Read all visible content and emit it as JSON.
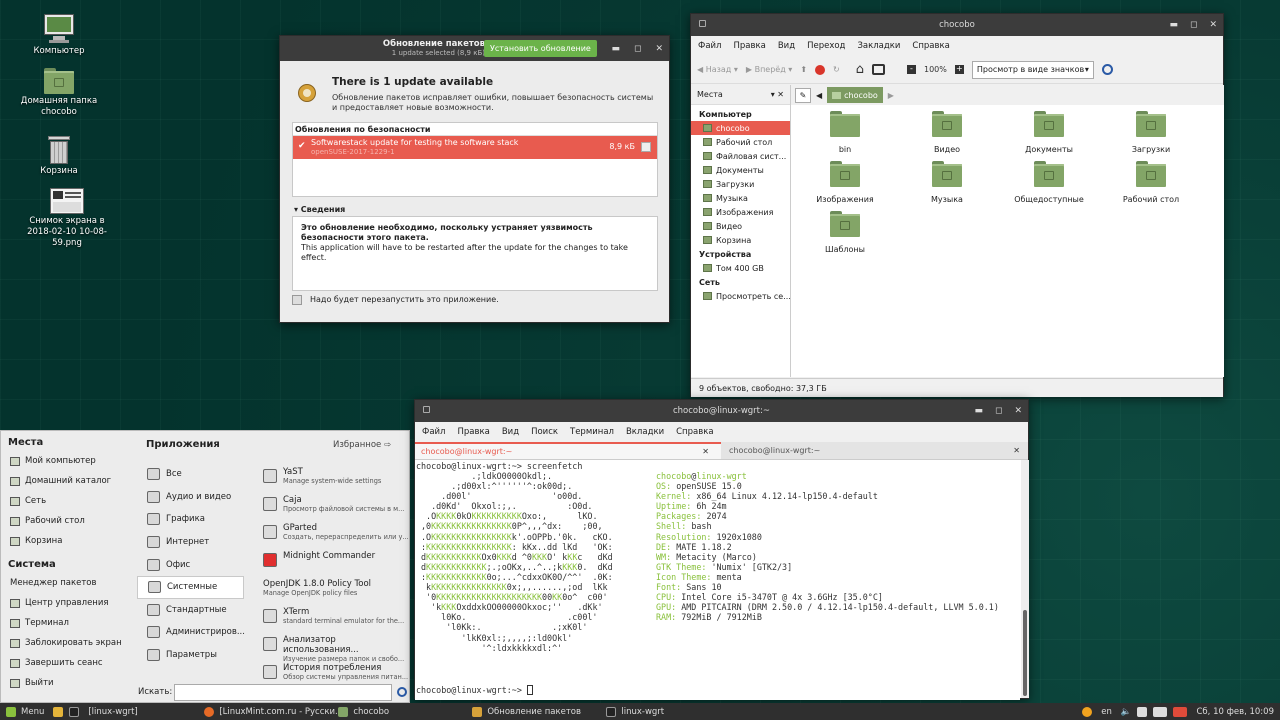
{
  "desktop": {
    "icons": [
      {
        "label": "Компьютер"
      },
      {
        "label": "Домашняя папка chocobo"
      },
      {
        "label": "Корзина"
      },
      {
        "label": "Снимок экрана в 2018-02-10 10-08-59.png"
      }
    ]
  },
  "updater": {
    "title": "Обновление пакетов",
    "subtitle": "1 update selected (8,9 кБ)",
    "install_button": "Установить обновление",
    "heading": "There is 1 update available",
    "description": "Обновление пакетов исправляет ошибки, повышает безопасность системы и предоставляет новые возможности.",
    "section": "Обновления по безопасности",
    "update": {
      "name": "Softwarestack update for testing the software stack",
      "version": "openSUSE-2017-1229-1",
      "size": "8,9 кБ"
    },
    "details_label": "▾ Сведения",
    "details_bold": "Это обновление необходимо, поскольку устраняет уязвимость безопасности этого пакета.",
    "details_text": "This application will have to be restarted after the update for the changes to take effect.",
    "restart_note": "Надо будет перезапустить это приложение."
  },
  "filemanager": {
    "title": "chocobo",
    "menu": [
      "Файл",
      "Правка",
      "Вид",
      "Переход",
      "Закладки",
      "Справка"
    ],
    "back": "Назад",
    "forward": "Вперёд",
    "zoom": "100%",
    "view_mode": "Просмотр в виде значков",
    "places_label": "Места",
    "path": "chocobo",
    "sidebar": [
      {
        "type": "header",
        "label": "Компьютер"
      },
      {
        "type": "item",
        "label": "chocobo",
        "selected": true
      },
      {
        "type": "item",
        "label": "Рабочий стол"
      },
      {
        "type": "item",
        "label": "Файловая сист..."
      },
      {
        "type": "item",
        "label": "Документы"
      },
      {
        "type": "item",
        "label": "Загрузки"
      },
      {
        "type": "item",
        "label": "Музыка"
      },
      {
        "type": "item",
        "label": "Изображения"
      },
      {
        "type": "item",
        "label": "Видео"
      },
      {
        "type": "item",
        "label": "Корзина"
      },
      {
        "type": "header",
        "label": "Устройства"
      },
      {
        "type": "item",
        "label": "Том 400 GB"
      },
      {
        "type": "header",
        "label": "Сеть"
      },
      {
        "type": "item",
        "label": "Просмотреть се..."
      }
    ],
    "files": [
      "bin",
      "Видео",
      "Документы",
      "Загрузки",
      "Изображения",
      "Музыка",
      "Общедоступные",
      "Рабочий стол",
      "Шаблоны"
    ],
    "status": "9 объектов, свободно: 37,3 ГБ"
  },
  "terminal": {
    "title": "chocobo@linux-wgrt:~",
    "menu": [
      "Файл",
      "Правка",
      "Вид",
      "Поиск",
      "Терминал",
      "Вкладки",
      "Справка"
    ],
    "tabs": [
      "chocobo@linux-wgrt:~",
      "chocobo@linux-wgrt:~"
    ],
    "prompt_cmd": "chocobo@linux-wgrt:~> screenfetch",
    "art": [
      "          .;ldkO0000Okdl;.",
      "      .;d00xl:^''''''^:ok00d;.",
      "    .d00l'                'o00d.",
      "  .d0Kd'  Okxol:;,.          :O0d.",
      " .OKKKK0kOKKKKKKKKKKOxo:,      lKO.",
      ",0KKKKKKKKKKKKKKKK0P^,,,^dx:    ;00,",
      ".OKKKKKKKKKKKKKKKKk'.oOPPb.'0k.   cKO.",
      ":KKKKKKKKKKKKKKKKK: kKx..dd lKd   'OK:",
      "dKKKKKKKKKKKOx0KKKd ^0KKKO' kKKc   dKd",
      "dKKKKKKKKKKKK;.;oOKx,..^..;kKKK0.  dKd",
      ":KKKKKKKKKKKK0o;...^cdxxOK0O/^^'  .0K:",
      " kKKKKKKKKKKKKKKK0x;,,......,;od  lKk",
      " '0KKKKKKKKKKKKKKKKKKKKK00KK0o^  c00'",
      "  'kKKKOxddxkOO00000Okxoc;''   .dKk'",
      "    l0Ko.                    .c00l'",
      "     'l0Kk:.              .;xK0l'",
      "        'lkK0xl:;,,,,;:ld0Okl'",
      "            '^:ldxkkkkxdl:^'"
    ],
    "info_user": "chocobo",
    "info_at": "@",
    "info_host": "linux-wgrt",
    "info": [
      {
        "k": "OS:",
        "v": "openSUSE 15.0"
      },
      {
        "k": "Kernel:",
        "v": "x86_64 Linux 4.12.14-lp150.4-default"
      },
      {
        "k": "Uptime:",
        "v": "6h 24m"
      },
      {
        "k": "Packages:",
        "v": "2074"
      },
      {
        "k": "Shell:",
        "v": "bash"
      },
      {
        "k": "Resolution:",
        "v": "1920x1080"
      },
      {
        "k": "DE:",
        "v": "MATE 1.18.2"
      },
      {
        "k": "WM:",
        "v": "Metacity (Marco)"
      },
      {
        "k": "GTK Theme:",
        "v": "'Numix' [GTK2/3]"
      },
      {
        "k": "Icon Theme:",
        "v": "menta"
      },
      {
        "k": "Font:",
        "v": "Sans 10"
      },
      {
        "k": "CPU:",
        "v": "Intel Core i5-3470T @ 4x 3.6GHz [35.0°C]"
      },
      {
        "k": "GPU:",
        "v": "AMD PITCAIRN (DRM 2.50.0 / 4.12.14-lp150.4-default, LLVM 5.0.1)"
      },
      {
        "k": "RAM:",
        "v": "792MiB / 7912MiB"
      }
    ],
    "prompt_end": "chocobo@linux-wgrt:~>"
  },
  "appmenu": {
    "places_title": "Места",
    "places": [
      "Мой компьютер",
      "Домашний каталог",
      "Сеть",
      "Рабочий стол",
      "Корзина"
    ],
    "system_title": "Система",
    "system": [
      "Менеджер пакетов",
      "Центр управления",
      "Терминал",
      "Заблокировать экран",
      "Завершить сеанс",
      "Выйти"
    ],
    "apps_title": "Приложения",
    "favorites": "Избранное",
    "categories": [
      "Все",
      "Аудио и видео",
      "Графика",
      "Интернет",
      "Офис",
      "Системные",
      "Стандартные",
      "Администриров...",
      "Параметры"
    ],
    "selected_category": "Системные",
    "apps": [
      {
        "name": "YaST",
        "desc": "Manage system-wide settings"
      },
      {
        "name": "Caja",
        "desc": "Просмотр файловой системы в м..."
      },
      {
        "name": "GParted",
        "desc": "Создать, перераспределить или у..."
      },
      {
        "name": "Midnight Commander",
        "desc": ""
      },
      {
        "name": "OpenJDK 1.8.0 Policy Tool",
        "desc": "Manage OpenJDK policy files"
      },
      {
        "name": "XTerm",
        "desc": "standard terminal emulator for the..."
      },
      {
        "name": "Анализатор использования...",
        "desc": "Изучение размера папок и свобо..."
      },
      {
        "name": "История потребления",
        "desc": "Обзор системы управления питан..."
      }
    ],
    "search_label": "Искать:"
  },
  "taskbar": {
    "menu": "Menu",
    "items": [
      "[linux-wgrt]",
      "[LinuxMint.com.ru - Русски...",
      "chocobo",
      "Обновление пакетов",
      "linux-wgrt"
    ],
    "lang": "en",
    "clock": "Сб, 10 фев, 10:09"
  },
  "colors": {
    "accent": "#8ac13d",
    "selected": "#e85b4f",
    "titlebar": "#3c3c3c"
  }
}
